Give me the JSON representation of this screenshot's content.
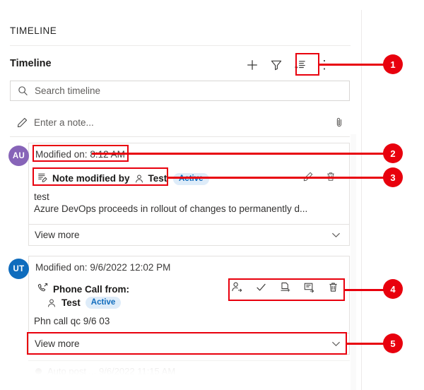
{
  "header": {
    "panel_title": "TIMELINE",
    "section_title": "Timeline"
  },
  "toolbar": {
    "add_label": "+",
    "filter_name": "filter-icon",
    "sort_name": "sort-icon",
    "more_label": "⋮"
  },
  "search": {
    "placeholder": "Search timeline",
    "value": ""
  },
  "composer": {
    "placeholder": "Enter a note...",
    "value": "",
    "attach_name": "paperclip-icon"
  },
  "entries": [
    {
      "avatar_initials": "AU",
      "avatar_color": "#8764b8",
      "modified_label": "Modified on:",
      "modified_time": "8:12 AM",
      "record_title": "Note modified by",
      "record_person": "Test",
      "status": "Active",
      "body_line_1": "test",
      "body_line_2": "Azure DevOps proceeds in rollout of changes to permanently d...",
      "view_more": "View more",
      "actions": [
        "edit-icon",
        "delete-icon"
      ]
    },
    {
      "avatar_initials": "UT",
      "avatar_color": "#0f6cbd",
      "modified_label": "Modified on:",
      "modified_time": "9/6/2022 12:02 PM",
      "record_title": "Phone Call from:",
      "record_person": "Test",
      "status": "Active",
      "body_line_1": "Phn call qc 9/6 03",
      "view_more": "View more",
      "actions": [
        "assign-icon",
        "mark-complete-icon",
        "add-to-queue-icon",
        "convert-icon",
        "delete-icon"
      ]
    }
  ],
  "faded_entry": {
    "text": "Auto post ... 9/6/2022 11:15 AM"
  },
  "annotations": {
    "accent_color": "#e8000d",
    "badges": [
      {
        "number": "1",
        "target": "sort-toolbar-button"
      },
      {
        "number": "2",
        "target": "modified-on-label"
      },
      {
        "number": "3",
        "target": "note-record-title"
      },
      {
        "number": "4",
        "target": "phonecall-action-icons"
      },
      {
        "number": "5",
        "target": "phonecall-view-more"
      }
    ]
  }
}
